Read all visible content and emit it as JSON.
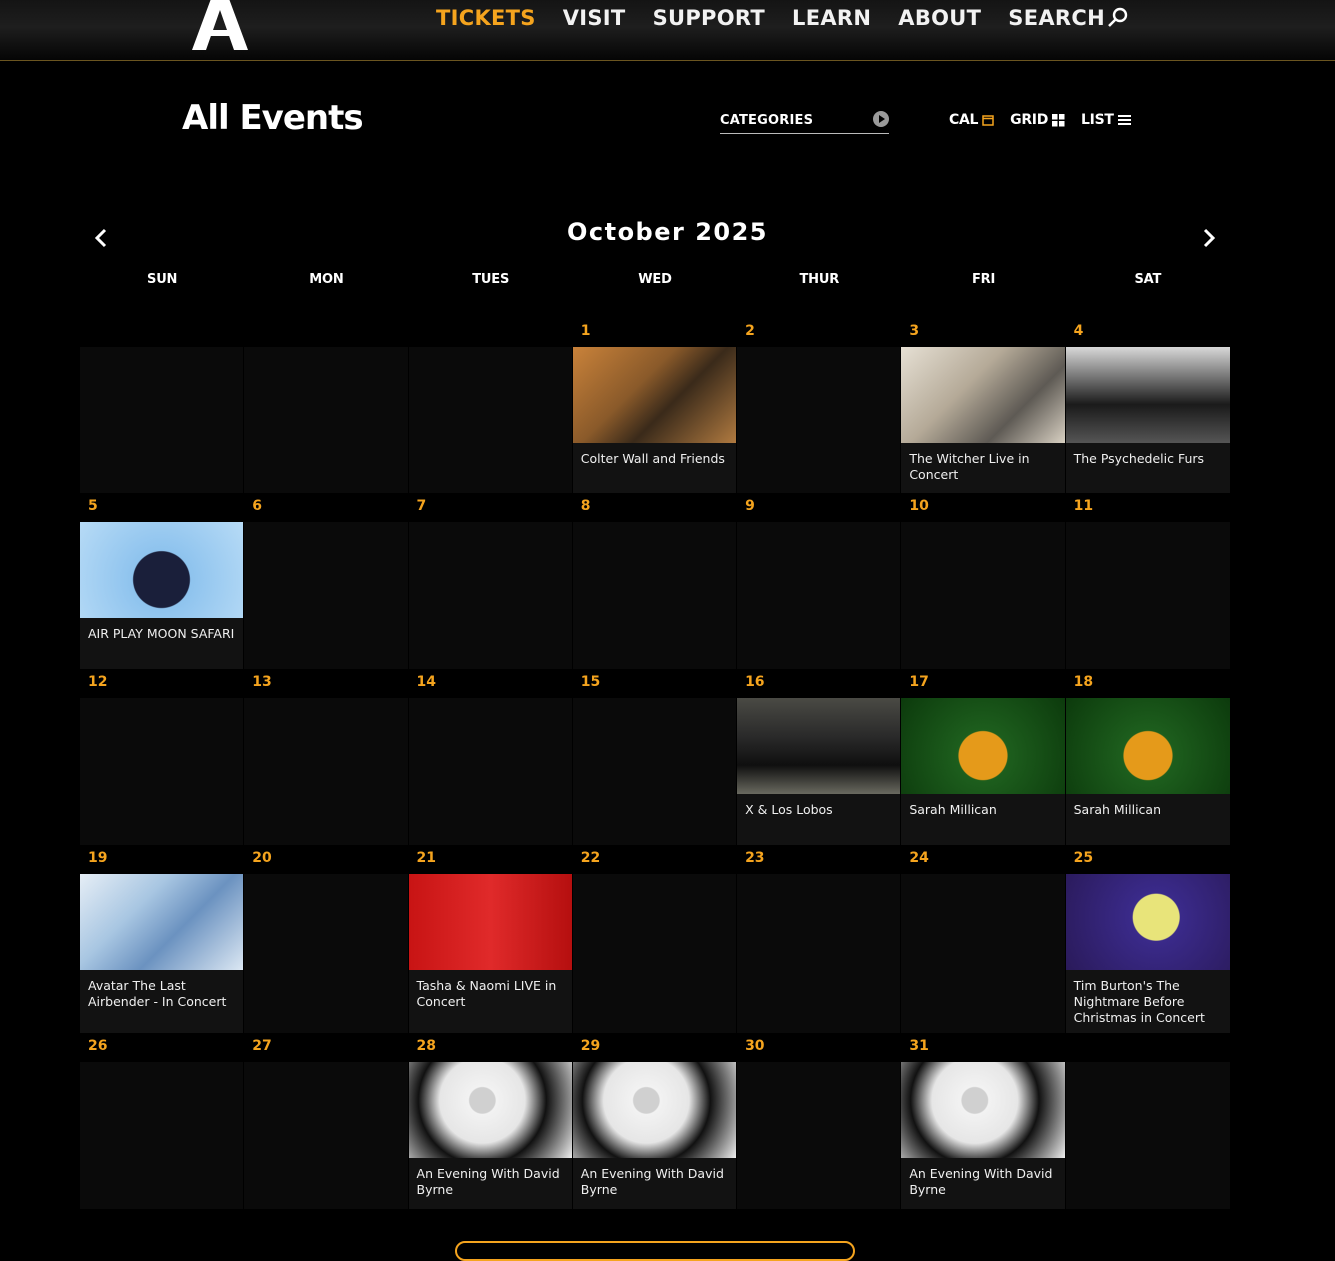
{
  "nav": {
    "items": [
      "TICKETS",
      "VISIT",
      "SUPPORT",
      "LEARN",
      "ABOUT"
    ],
    "search_label": "SEARCH",
    "active": "TICKETS"
  },
  "page": {
    "title": "All Events",
    "categories_label": "CATEGORIES",
    "views": [
      "CAL",
      "GRID",
      "LIST"
    ]
  },
  "calendar": {
    "month": "October 2025",
    "days_of_week": [
      "SUN",
      "MON",
      "TUES",
      "WED",
      "THUR",
      "FRI",
      "SAT"
    ],
    "weeks": [
      [
        {
          "day": "",
          "event": null
        },
        {
          "day": "",
          "event": null
        },
        {
          "day": "",
          "event": null
        },
        {
          "day": "1",
          "event": "Colter Wall and Friends"
        },
        {
          "day": "2",
          "event": null
        },
        {
          "day": "3",
          "event": "The Witcher Live in Concert"
        },
        {
          "day": "4",
          "event": "The Psychedelic Furs"
        }
      ],
      [
        {
          "day": "5",
          "event": "AIR PLAY MOON SAFARI"
        },
        {
          "day": "6",
          "event": null
        },
        {
          "day": "7",
          "event": null
        },
        {
          "day": "8",
          "event": null
        },
        {
          "day": "9",
          "event": null
        },
        {
          "day": "10",
          "event": null
        },
        {
          "day": "11",
          "event": null
        }
      ],
      [
        {
          "day": "12",
          "event": null
        },
        {
          "day": "13",
          "event": null
        },
        {
          "day": "14",
          "event": null
        },
        {
          "day": "15",
          "event": null
        },
        {
          "day": "16",
          "event": "X & Los Lobos"
        },
        {
          "day": "17",
          "event": "Sarah Millican"
        },
        {
          "day": "18",
          "event": "Sarah Millican"
        }
      ],
      [
        {
          "day": "19",
          "event": "Avatar The Last Airbender - In Concert"
        },
        {
          "day": "20",
          "event": null
        },
        {
          "day": "21",
          "event": "Tasha & Naomi LIVE in Concert"
        },
        {
          "day": "22",
          "event": null
        },
        {
          "day": "23",
          "event": null
        },
        {
          "day": "24",
          "event": null
        },
        {
          "day": "25",
          "event": "Tim Burton's The Nightmare Before Christmas in Concert"
        }
      ],
      [
        {
          "day": "26",
          "event": null
        },
        {
          "day": "27",
          "event": null
        },
        {
          "day": "28",
          "event": "An Evening With David Byrne"
        },
        {
          "day": "29",
          "event": "An Evening With David Byrne"
        },
        {
          "day": "30",
          "event": null
        },
        {
          "day": "31",
          "event": "An Evening With David Byrne"
        },
        {
          "day": "",
          "event": null
        }
      ]
    ]
  },
  "colors": {
    "accent": "#f5a41e",
    "background": "#000000",
    "cell": "#121212"
  }
}
